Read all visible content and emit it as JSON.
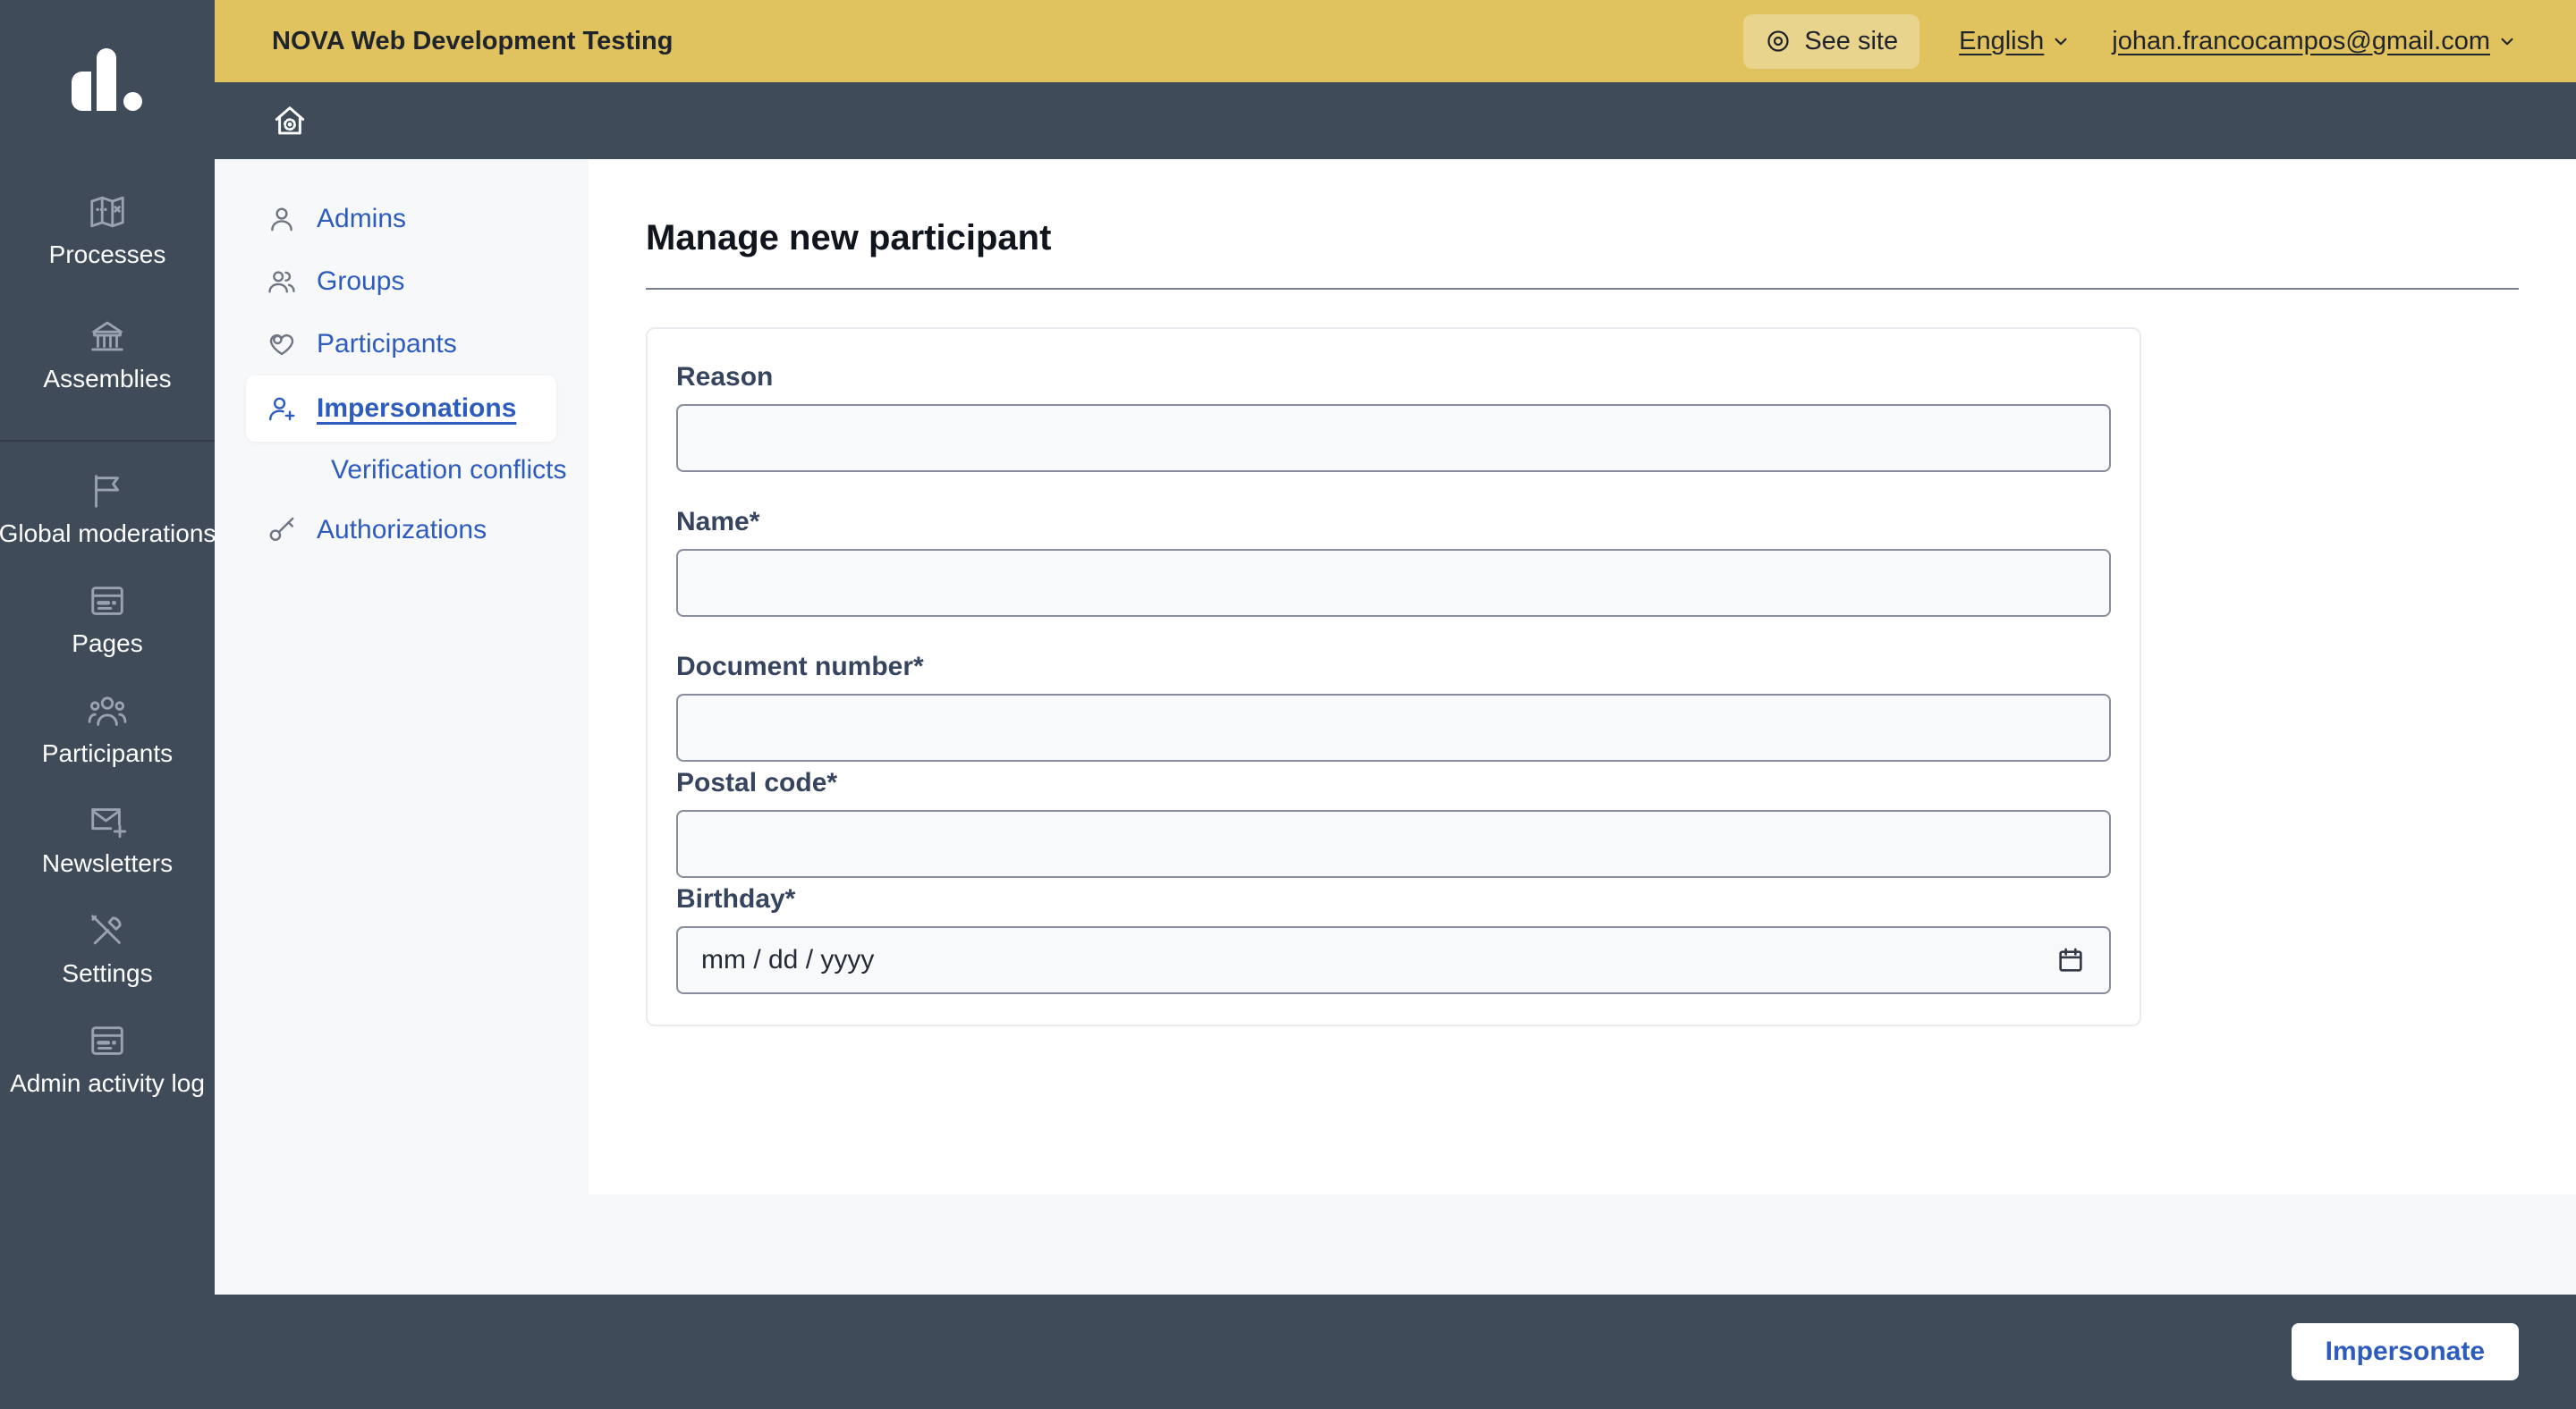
{
  "colors": {
    "brand_yellow": "#e0c25e",
    "primary_blue": "#2d5cbe",
    "slate_dark": "#404b5a",
    "panel_gray": "#f7f8fa"
  },
  "top_bar": {
    "title": "NOVA Web Development Testing",
    "see_site_label": "See site",
    "see_site_icon": "double-circle-icon",
    "language_label": "English",
    "user_email": "johan.francocampos@gmail.com"
  },
  "header": {
    "home_icon": "home-gear-icon"
  },
  "sidebar": {
    "items": [
      {
        "icon": "treasure-map-icon",
        "label": "Processes"
      },
      {
        "icon": "bank-icon",
        "label": "Assemblies"
      },
      {
        "icon": "flag-icon",
        "label": "Global moderations"
      },
      {
        "icon": "article-icon",
        "label": "Pages"
      },
      {
        "icon": "team-icon",
        "label": "Participants"
      },
      {
        "icon": "mail-add-icon",
        "label": "Newsletters"
      },
      {
        "icon": "tools-icon",
        "label": "Settings"
      },
      {
        "icon": "article-icon",
        "label": "Admin activity log"
      }
    ]
  },
  "menu": {
    "items": [
      {
        "icon": "user-icon",
        "label": "Admins",
        "active": false
      },
      {
        "icon": "group-icon",
        "label": "Groups",
        "active": false
      },
      {
        "icon": "heart-icon",
        "label": "Participants",
        "active": false
      },
      {
        "icon": "user-add-icon",
        "label": "Impersonations",
        "active": true
      },
      {
        "icon": "",
        "label": "Verification conflicts",
        "active": false
      },
      {
        "icon": "key-icon",
        "label": "Authorizations",
        "active": false
      }
    ]
  },
  "main": {
    "title": "Manage new participant",
    "form": {
      "fields": [
        {
          "label": "Reason",
          "value": "",
          "type": "text"
        },
        {
          "label": "Name*",
          "value": "",
          "type": "text"
        },
        {
          "label": "Document number*",
          "value": "",
          "type": "text"
        },
        {
          "label": "Postal code*",
          "value": "",
          "type": "text"
        },
        {
          "label": "Birthday*",
          "value": "",
          "type": "date",
          "placeholder": "mm / dd / yyyy",
          "icon": "calendar-icon"
        }
      ]
    }
  },
  "footer": {
    "impersonate_label": "Impersonate"
  }
}
